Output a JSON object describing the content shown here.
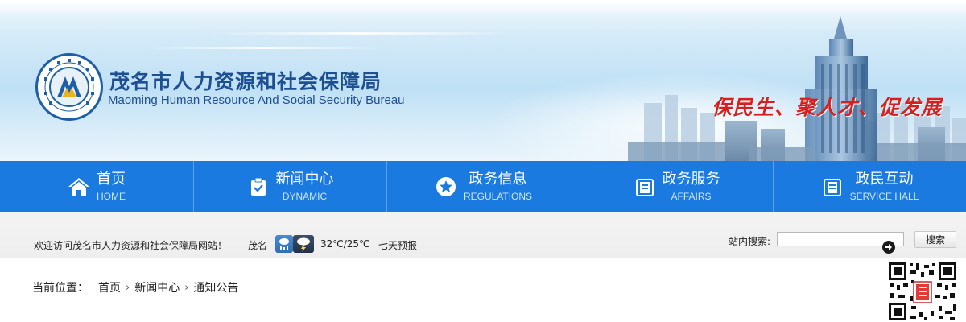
{
  "header": {
    "title": "茂名市人力资源和社会保障局",
    "subtitle": "Maoming Human Resource And Social Security Bureau",
    "slogan": "保民生、聚人才、促发展",
    "emblem_icon": "bureau-emblem-icon"
  },
  "nav": {
    "items": [
      {
        "label": "首页",
        "sublabel": "HOME",
        "icon": "home-icon"
      },
      {
        "label": "新闻中心",
        "sublabel": "DYNAMIC",
        "icon": "clipboard-check-icon"
      },
      {
        "label": "政务信息",
        "sublabel": "REGULATIONS",
        "icon": "star-circle-icon"
      },
      {
        "label": "政务服务",
        "sublabel": "AFFAIRS",
        "icon": "document-icon"
      },
      {
        "label": "政民互动",
        "sublabel": "SERVICE HALL",
        "icon": "document-icon"
      }
    ]
  },
  "infobar": {
    "welcome": "欢迎访问茂名市人力资源和社会保障局网站！",
    "city": "茂名",
    "weather_icons": [
      "rain-icon",
      "thunderstorm-icon"
    ],
    "temperature": "32℃/25℃",
    "forecast_link": "七天预报",
    "search_label": "站内搜索:",
    "search_value": "",
    "search_button": "搜索"
  },
  "breadcrumb": {
    "label": "当前位置：",
    "items": [
      "首页",
      "新闻中心",
      "通知公告"
    ]
  },
  "colors": {
    "nav_bg": "#1a7ae0",
    "title": "#1d4f93",
    "slogan": "#d62020"
  }
}
